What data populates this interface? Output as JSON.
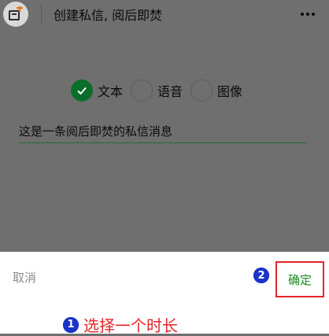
{
  "header": {
    "title": "创建私信, 阅后即焚"
  },
  "icons": {
    "app": "message-add-icon",
    "more": "more-dots-icon"
  },
  "type_options": [
    {
      "label": "文本",
      "checked": true
    },
    {
      "label": "语音",
      "checked": false
    },
    {
      "label": "图像",
      "checked": false
    }
  ],
  "message": {
    "value": "这是一条阅后即焚的私信消息"
  },
  "sheet": {
    "cancel_label": "取消",
    "confirm_label": "确定"
  },
  "annotations": {
    "step1_number": "1",
    "step1_text": "选择一个时长",
    "step2_number": "2"
  },
  "colors": {
    "accent_green": "#0a6e2a",
    "confirm_green": "#1a8a23",
    "annotation_red": "#e3262b",
    "badge_blue": "#1a33c8"
  }
}
